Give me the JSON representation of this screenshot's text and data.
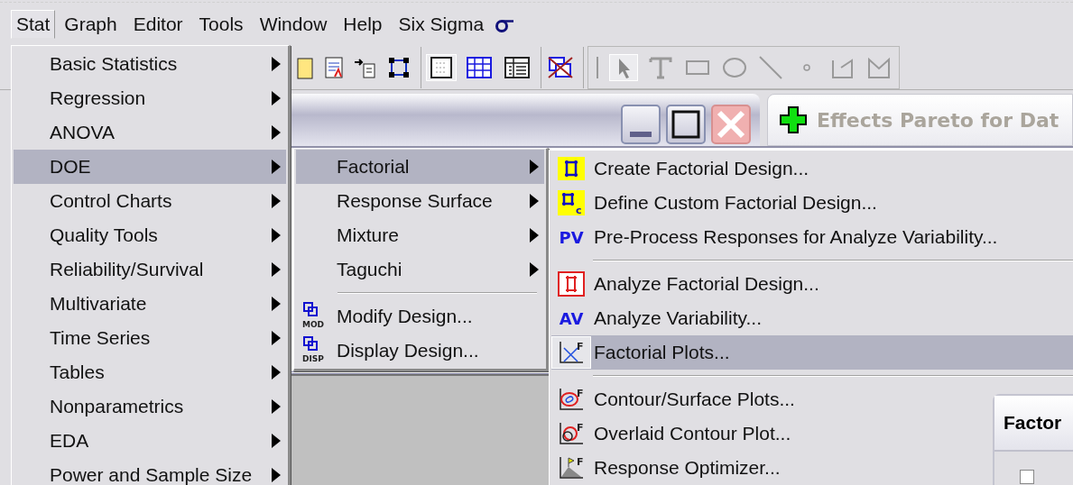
{
  "menubar": [
    {
      "label": "Stat",
      "selected": true
    },
    {
      "label": "Graph",
      "selected": false
    },
    {
      "label": "Editor",
      "selected": false
    },
    {
      "label": "Tools",
      "selected": false
    },
    {
      "label": "Window",
      "selected": false
    },
    {
      "label": "Help",
      "selected": false
    },
    {
      "label": "Six Sigma",
      "selected": false
    }
  ],
  "document_window": {
    "tab_title": "Effects Pareto for Dat"
  },
  "stat_menu": {
    "items": [
      {
        "kind": "submenu",
        "label": "Basic Statistics",
        "selected": false
      },
      {
        "kind": "submenu",
        "label": "Regression",
        "selected": false
      },
      {
        "kind": "submenu",
        "label": "ANOVA",
        "selected": false
      },
      {
        "kind": "submenu",
        "label": "DOE",
        "selected": true
      },
      {
        "kind": "submenu",
        "label": "Control Charts",
        "selected": false
      },
      {
        "kind": "submenu",
        "label": "Quality Tools",
        "selected": false
      },
      {
        "kind": "submenu",
        "label": "Reliability/Survival",
        "selected": false
      },
      {
        "kind": "submenu",
        "label": "Multivariate",
        "selected": false
      },
      {
        "kind": "submenu",
        "label": "Time Series",
        "selected": false
      },
      {
        "kind": "submenu",
        "label": "Tables",
        "selected": false
      },
      {
        "kind": "submenu",
        "label": "Nonparametrics",
        "selected": false
      },
      {
        "kind": "submenu",
        "label": "EDA",
        "selected": false
      },
      {
        "kind": "submenu",
        "label": "Power and Sample Size",
        "selected": false
      }
    ]
  },
  "doe_menu": {
    "items": [
      {
        "kind": "submenu",
        "label": "Factorial",
        "selected": true
      },
      {
        "kind": "submenu",
        "label": "Response Surface",
        "selected": false
      },
      {
        "kind": "submenu",
        "label": "Mixture",
        "selected": false
      },
      {
        "kind": "submenu",
        "label": "Taguchi",
        "selected": false
      },
      {
        "kind": "separator"
      },
      {
        "kind": "command",
        "icon_text": "MOD",
        "label": "Modify Design...",
        "selected": false
      },
      {
        "kind": "command",
        "icon_text": "DISP",
        "label": "Display Design...",
        "selected": false
      }
    ]
  },
  "factorial_menu": {
    "items": [
      {
        "kind": "command",
        "label": "Create Factorial Design...",
        "selected": false
      },
      {
        "kind": "command",
        "icon_text": "c",
        "label": "Define Custom Factorial Design...",
        "selected": false
      },
      {
        "kind": "command",
        "icon_text": "PV",
        "label": "Pre-Process Responses for Analyze Variability...",
        "selected": false
      },
      {
        "kind": "separator"
      },
      {
        "kind": "command",
        "label": "Analyze Factorial Design...",
        "selected": false
      },
      {
        "kind": "command",
        "icon_text": "AV",
        "label": "Analyze Variability...",
        "selected": false
      },
      {
        "kind": "command",
        "icon_text": "F",
        "label": "Factorial Plots...",
        "selected": true
      },
      {
        "kind": "separator"
      },
      {
        "kind": "command",
        "icon_text": "F",
        "label": "Contour/Surface Plots...",
        "selected": false
      },
      {
        "kind": "command",
        "icon_text": "F",
        "label": "Overlaid Contour Plot...",
        "selected": false
      },
      {
        "kind": "command",
        "icon_text": "F",
        "label": "Response Optimizer...",
        "selected": false
      }
    ]
  },
  "dialog": {
    "title": "Factor",
    "checkbox": {
      "checked": false
    }
  }
}
